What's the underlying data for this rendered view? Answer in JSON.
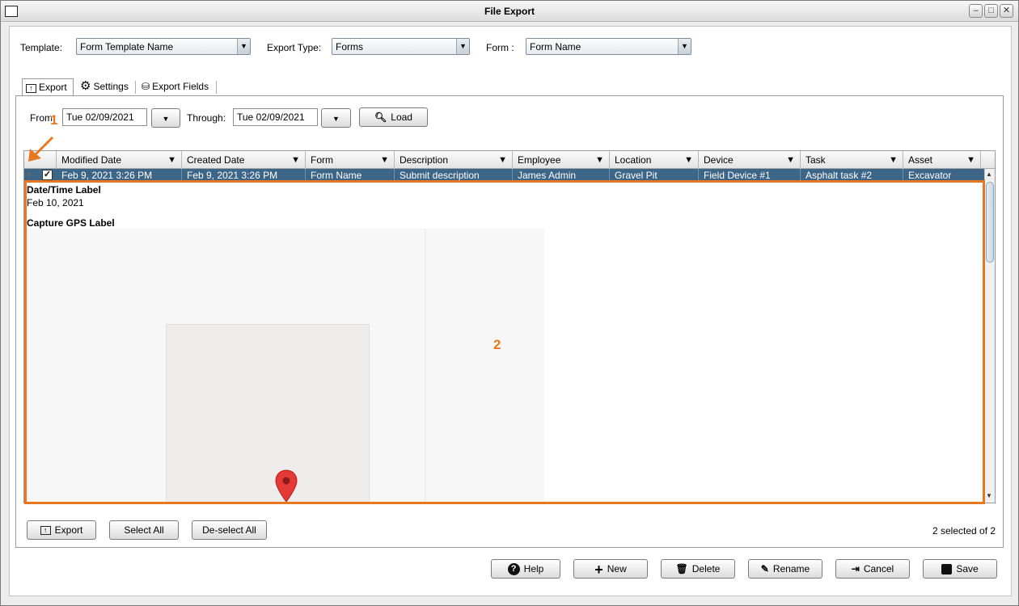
{
  "window": {
    "title": "File Export"
  },
  "selectors": {
    "template_label": "Template:",
    "template_value": "Form Template Name",
    "export_type_label": "Export Type:",
    "export_type_value": "Forms",
    "form_label": "Form :",
    "form_value": "Form Name"
  },
  "tabs": [
    {
      "label": "Export",
      "icon": "export-icon"
    },
    {
      "label": "Settings",
      "icon": "gear-icon"
    },
    {
      "label": "Export Fields",
      "icon": "database-icon"
    }
  ],
  "filters": {
    "from_label": "From:",
    "from_value": "Tue 02/09/2021",
    "through_label": "Through:",
    "through_value": "Tue 02/09/2021",
    "load_label": "Load"
  },
  "table": {
    "columns": [
      "Modified Date",
      "Created Date",
      "Form",
      "Description",
      "Employee",
      "Location",
      "Device",
      "Task",
      "Asset"
    ],
    "selected_row": [
      "Feb 9, 2021 3:26 PM",
      "Feb 9, 2021 3:26 PM",
      "Form Name",
      "Submit description",
      "James Admin",
      "Gravel Pit",
      "Field Device #1",
      "Asphalt task #2",
      "Excavator"
    ],
    "row_checked": true
  },
  "detail": {
    "datetime_label": "Date/Time Label",
    "datetime_value": "Feb 10, 2021",
    "gps_label": "Capture GPS Label"
  },
  "annotations": {
    "callout_1": "1",
    "callout_2": "2",
    "color": "#e87722"
  },
  "bottom": {
    "export_label": "Export",
    "select_all_label": "Select All",
    "deselect_all_label": "De-select All",
    "selection_count": "2 selected of 2"
  },
  "actions": {
    "help": "Help",
    "new": "New",
    "delete": "Delete",
    "rename": "Rename",
    "cancel": "Cancel",
    "save": "Save"
  }
}
